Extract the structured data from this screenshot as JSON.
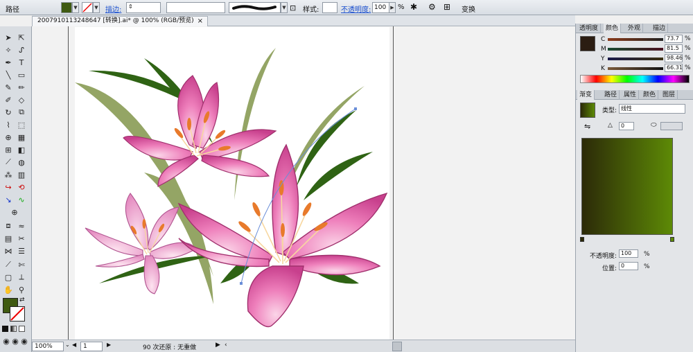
{
  "control_bar": {
    "path_label": "路径",
    "stroke_link": "描边:",
    "style_label": "样式:",
    "opacity_link": "不透明度:",
    "opacity_value": "100",
    "percent": "%",
    "transform_link": "变换"
  },
  "document": {
    "tab_title": "2007910113248647 [转换].ai* @ 100% (RGB/预览)",
    "close_glyph": "×"
  },
  "status_bar": {
    "zoom": "100%",
    "artboard": "1",
    "undo_text": "90 次还原 : 无重做"
  },
  "color_panel": {
    "tabs": [
      "透明度",
      "颜色",
      "外观",
      "描边"
    ],
    "active_tab": "颜色",
    "channels": [
      {
        "name": "C",
        "value": "73.7"
      },
      {
        "name": "M",
        "value": "81.5"
      },
      {
        "name": "Y",
        "value": "98.46"
      },
      {
        "name": "K",
        "value": "66.31"
      }
    ],
    "percent": "%",
    "swatch_color": "#2b1d12"
  },
  "gradient_panel": {
    "tabs": [
      "渐变",
      "路径",
      "属性",
      "颜色",
      "图层"
    ],
    "active_tab": "渐变",
    "type_label": "类型:",
    "type_value": "线性",
    "angle_value": "0",
    "opacity_label": "不透明度:",
    "opacity_value": "100",
    "location_label": "位置:",
    "location_value": "0",
    "percent": "%",
    "gradient_start": "#2c2a08",
    "gradient_end": "#5d8a06"
  },
  "colors": {
    "fill_swatch": "#3f5a12",
    "leaf_dark": "#2f6314",
    "leaf_light": "#94a565",
    "petal": "#e96fb0",
    "petal_light": "#f4a9cf",
    "stamen": "#e87a2b"
  }
}
